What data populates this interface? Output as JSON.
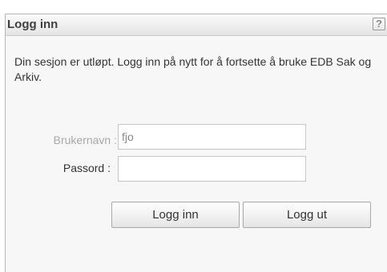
{
  "dialog": {
    "title": "Logg inn",
    "help_icon": "help-icon",
    "help_symbol": "?",
    "message": "Din sesjon er utløpt. Logg inn på nytt for å fortsette å bruke EDB Sak og Arkiv.",
    "username_label": "Brukernavn :",
    "username_value": "fjo",
    "password_label": "Passord :",
    "password_value": "",
    "login_button": "Logg inn",
    "logout_button": "Logg ut"
  }
}
